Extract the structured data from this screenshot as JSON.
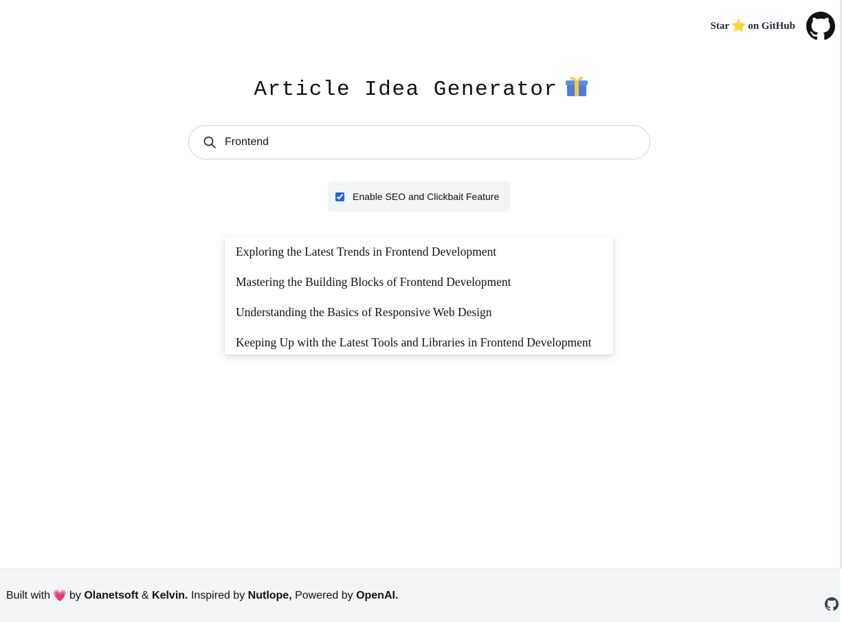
{
  "header": {
    "star_text": "Star",
    "star_glyph": "⭐",
    "on_github_text": "on GitHub",
    "github_icon": "github-icon"
  },
  "main": {
    "title": "Article Idea Generator",
    "title_emoji_icon": "gift-icon",
    "search": {
      "value": "Frontend",
      "icon": "search-icon"
    },
    "seo_checkbox": {
      "label": "Enable SEO and Clickbait Feature",
      "checked": true
    },
    "ideas": [
      "Exploring the Latest Trends in Frontend Development",
      "Mastering the Building Blocks of Frontend Development",
      "Understanding the Basics of Responsive Web Design",
      "Keeping Up with the Latest Tools and Libraries in Frontend Development"
    ]
  },
  "footer": {
    "built_with": "Built with",
    "heart": "💗",
    "by": "by",
    "author1": "Olanetsoft",
    "amp": "&",
    "author2": "Kelvin.",
    "inspired_by": "Inspired by",
    "inspiration": "Nutlope,",
    "powered_by": "Powered by",
    "provider": "OpenAI."
  },
  "colors": {
    "accent": "#2563eb",
    "footer_bg": "#f3f4f6",
    "heart": "#ec4899",
    "star": "#f5c518"
  }
}
